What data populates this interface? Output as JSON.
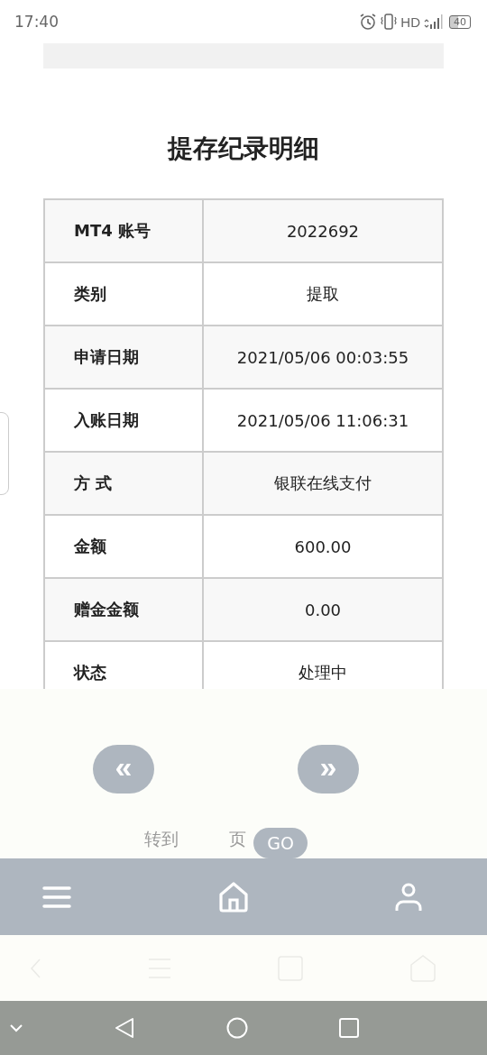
{
  "status_bar": {
    "time": "17:40",
    "network": "HD",
    "battery": "40"
  },
  "title": "提存纪录明细",
  "details": [
    {
      "label": "MT4 账号",
      "value": "2022692"
    },
    {
      "label": "类别",
      "value": "提取"
    },
    {
      "label": "申请日期",
      "value": "2021/05/06 00:03:55"
    },
    {
      "label": "入账日期",
      "value": "2021/05/06 11:06:31"
    },
    {
      "label": "方 式",
      "value": "银联在线支付"
    },
    {
      "label": "金额",
      "value": "600.00"
    },
    {
      "label": "赠金金额",
      "value": "0.00"
    },
    {
      "label": "状态",
      "value": "处理中"
    }
  ],
  "pager": {
    "prev": "«",
    "next": "»",
    "jump_before": "转到",
    "jump_after": "页",
    "go": "GO"
  }
}
